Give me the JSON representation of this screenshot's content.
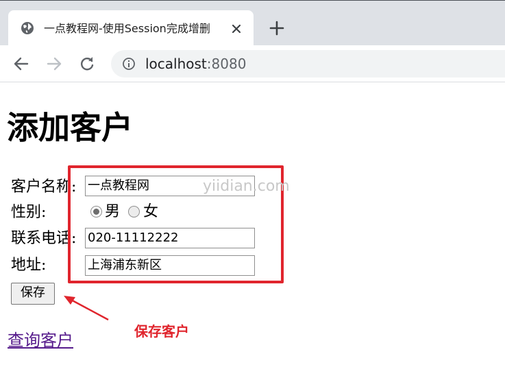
{
  "browser": {
    "tab_title": "一点教程网-使用Session完成增删",
    "favicon_icon": "globe-icon",
    "close_icon": "close-icon",
    "new_tab_icon": "plus-icon",
    "back_icon": "back-arrow-icon",
    "forward_icon": "forward-arrow-icon",
    "reload_icon": "reload-icon",
    "info_icon": "info-icon",
    "url_host": "localhost",
    "url_port": ":8080"
  },
  "page": {
    "title": "添加客户",
    "form": {
      "name_label": "客户名称:",
      "name_value": "一点教程网",
      "gender_label": "性别:",
      "gender_options": [
        "男",
        "女"
      ],
      "gender_selected": "男",
      "phone_label": "联系电话:",
      "phone_value": "020-11112222",
      "address_label": "地址:",
      "address_value": "上海浦东新区",
      "save_button": "保存"
    },
    "query_link": "查询客户"
  },
  "annotations": {
    "watermark": "yiidian.com",
    "callout": "保存客户",
    "accent_color": "#e0252d"
  }
}
